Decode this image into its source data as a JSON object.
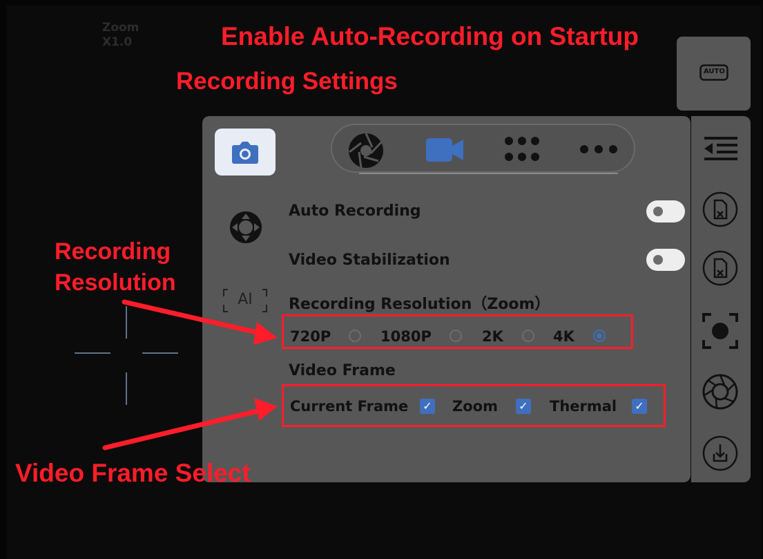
{
  "annotations": {
    "enable_auto": "Enable Auto-Recording on Startup",
    "recording_settings": "Recording Settings",
    "recording_res_line1": "Recording",
    "recording_res_line2": "Resolution",
    "video_frame_select": "Video Frame Select"
  },
  "viewfinder": {
    "zoom_label": "Zoom",
    "zoom_value": "X1.0"
  },
  "top_tabs": [
    {
      "icon": "aperture-icon"
    },
    {
      "icon": "video-camera-icon",
      "active": true
    },
    {
      "icon": "grid-dots-icon"
    },
    {
      "icon": "more-icon"
    }
  ],
  "left_tabs": [
    {
      "icon": "camera-icon",
      "active": true
    },
    {
      "icon": "dpad-icon"
    },
    {
      "icon": "ai-icon",
      "label": "AI"
    }
  ],
  "settings": {
    "auto_recording": {
      "label": "Auto Recording",
      "enabled": false
    },
    "video_stabilization": {
      "label": "Video Stabilization",
      "enabled": false
    },
    "resolution": {
      "label": "Recording Resolution（Zoom）",
      "options": [
        "720P",
        "1080P",
        "2K",
        "4K"
      ],
      "selected": "4K"
    },
    "video_frame": {
      "label": "Video Frame",
      "options": [
        {
          "label": "Current Frame",
          "checked": true
        },
        {
          "label": "Zoom",
          "checked": true
        },
        {
          "label": "Thermal",
          "checked": true
        }
      ]
    }
  },
  "right_rail": {
    "auto_label": "AUTO",
    "buttons": [
      "collapse-menu-icon",
      "sd-card-format-icon",
      "sd-card-format-icon",
      "focus-target-icon",
      "aperture-ring-icon",
      "download-icon"
    ]
  },
  "colors": {
    "annotation": "#ff1d2a",
    "accent": "#3e6fb8",
    "panel": "#575757"
  }
}
